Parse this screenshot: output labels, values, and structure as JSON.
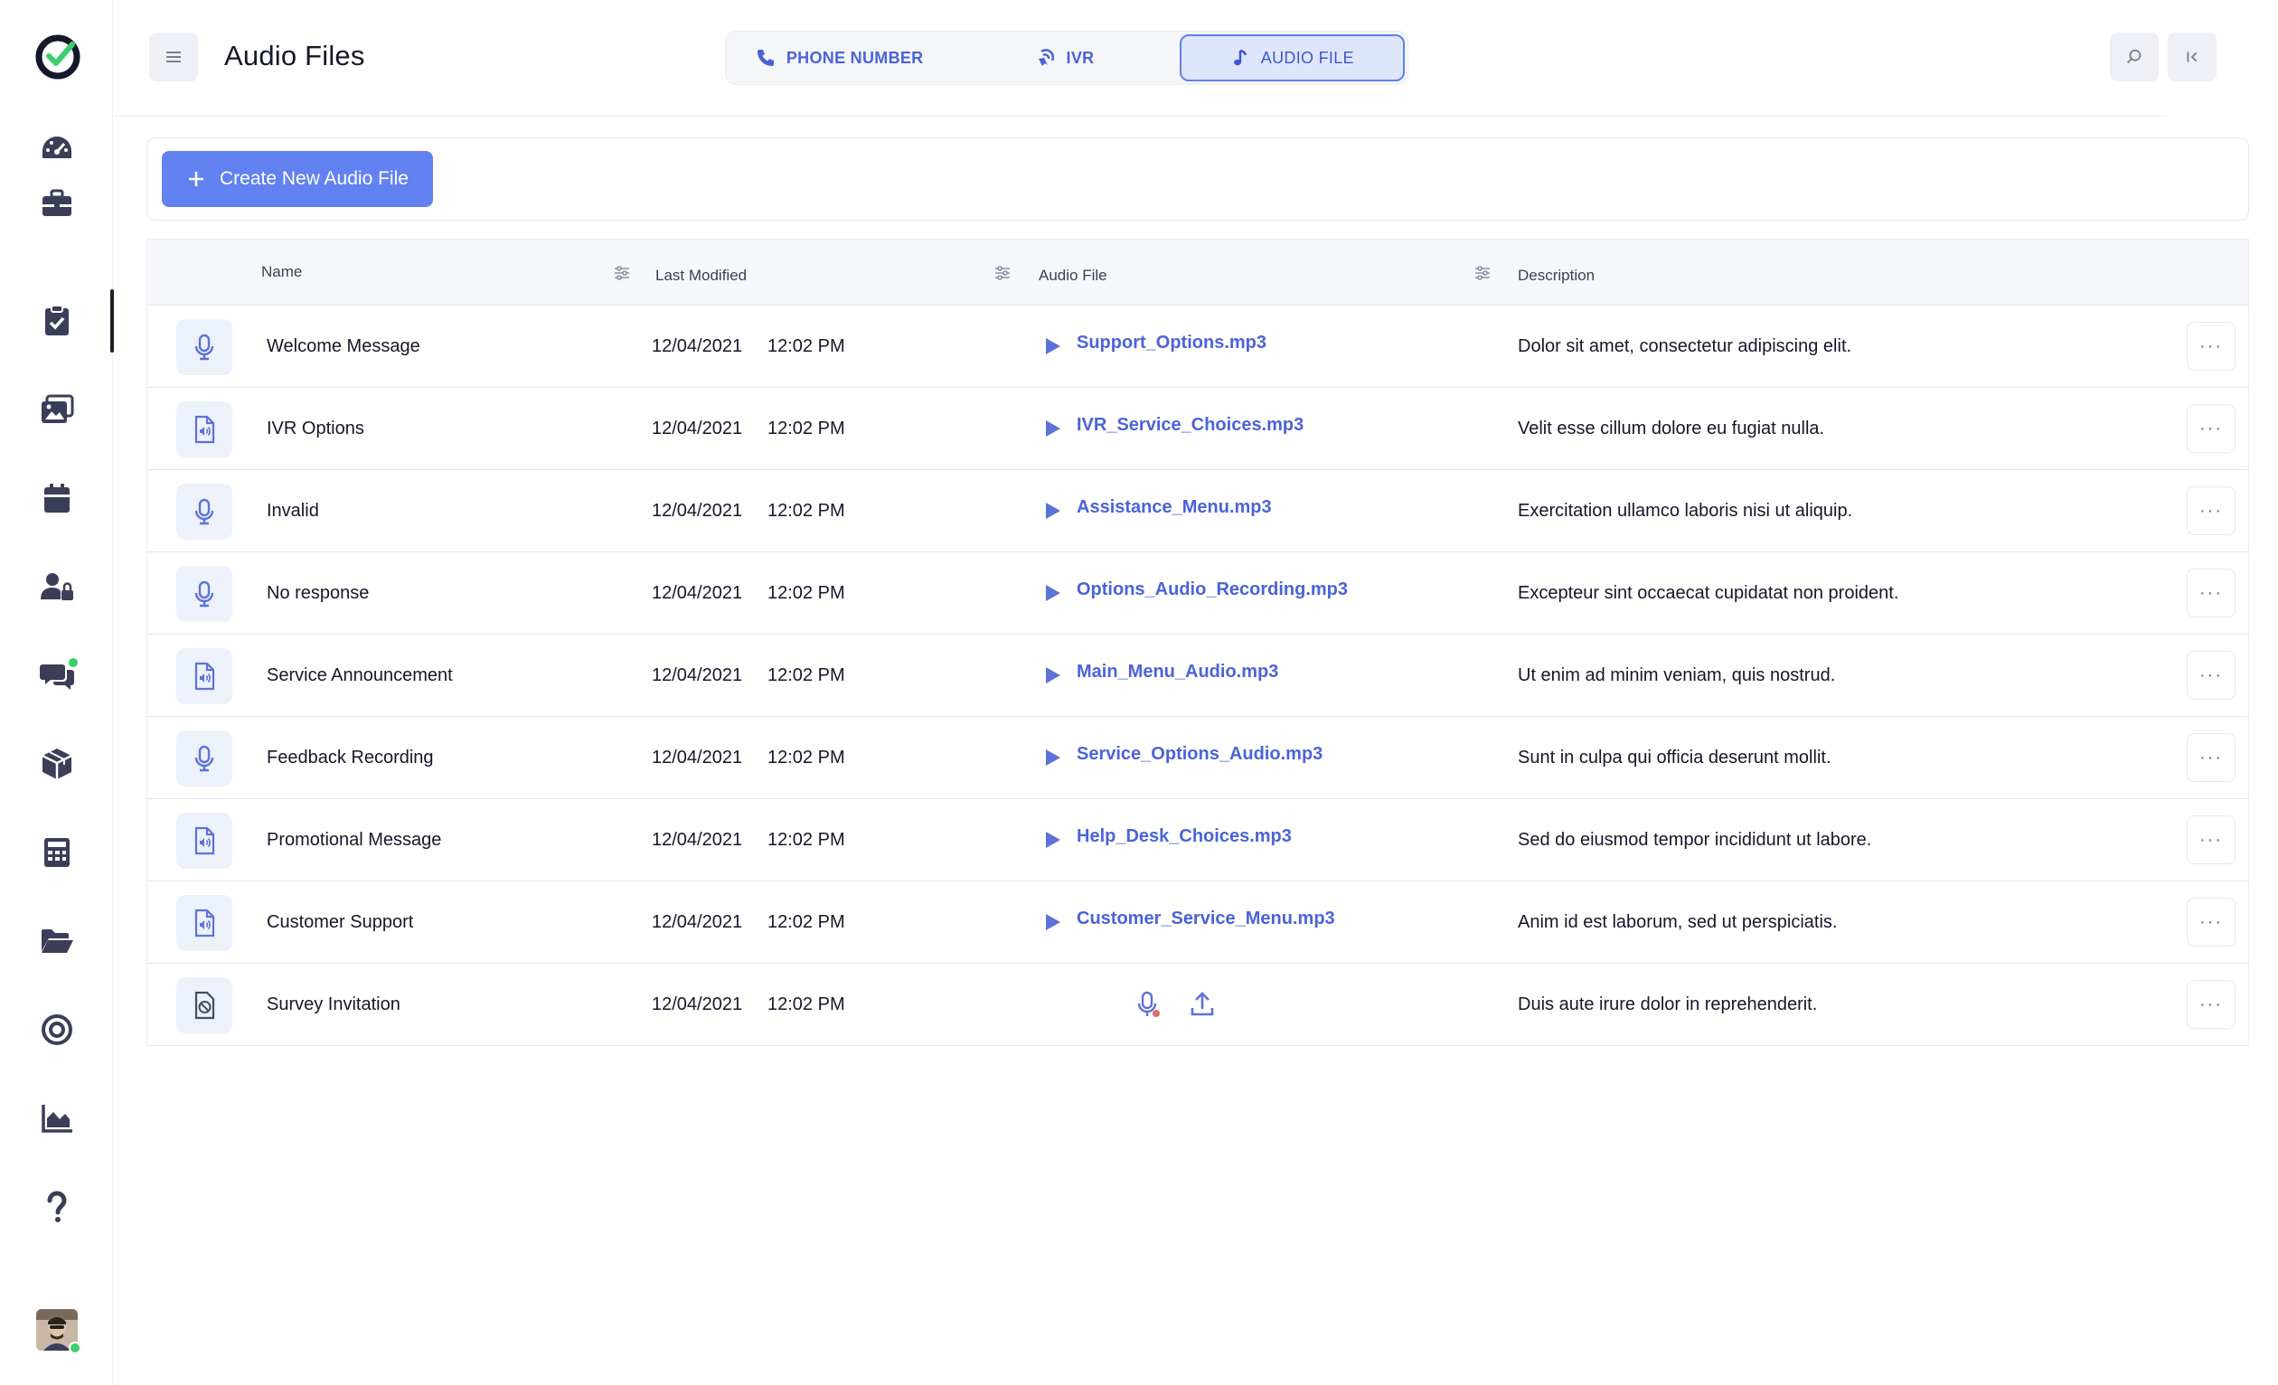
{
  "header": {
    "title": "Audio Files",
    "tabs": [
      {
        "label": "PHONE NUMBER",
        "icon": "phone-icon"
      },
      {
        "label": "IVR",
        "icon": "ivr-icon"
      },
      {
        "label": "AUDIO FILE",
        "icon": "music-note-icon",
        "active": true
      }
    ]
  },
  "sidebar": {
    "items": [
      "dashboard-icon",
      "briefcase-icon",
      "clipboard-check-icon",
      "gallery-icon",
      "calendar-icon",
      "user-lock-icon",
      "chat-icon",
      "box-icon",
      "calculator-icon",
      "folder-open-icon",
      "target-icon",
      "area-chart-icon",
      "help-icon"
    ],
    "active_index": 2
  },
  "toolbar": {
    "create_label": "Create New Audio File"
  },
  "table": {
    "columns": {
      "name": "Name",
      "modified": "Last Modified",
      "file": "Audio File",
      "description": "Description"
    },
    "rows": [
      {
        "icon": "microphone-icon",
        "name": "Welcome Message",
        "date": "12/04/2021",
        "time": "12:02 PM",
        "file": "Support_Options.mp3",
        "description": "Dolor sit amet, consectetur adipiscing elit."
      },
      {
        "icon": "audio-file-icon",
        "name": "IVR Options",
        "date": "12/04/2021",
        "time": "12:02 PM",
        "file": "IVR_Service_Choices.mp3",
        "description": "Velit esse cillum dolore eu fugiat nulla."
      },
      {
        "icon": "microphone-icon",
        "name": "Invalid",
        "date": "12/04/2021",
        "time": "12:02 PM",
        "file": "Assistance_Menu.mp3",
        "description": "Exercitation ullamco laboris nisi ut aliquip."
      },
      {
        "icon": "microphone-icon",
        "name": "No response",
        "date": "12/04/2021",
        "time": "12:02 PM",
        "file": "Options_Audio_Recording.mp3",
        "description": "Excepteur sint occaecat cupidatat non proident."
      },
      {
        "icon": "audio-file-icon",
        "name": "Service Announcement",
        "date": "12/04/2021",
        "time": "12:02 PM",
        "file": "Main_Menu_Audio.mp3",
        "description": "Ut enim ad minim veniam, quis nostrud."
      },
      {
        "icon": "microphone-icon",
        "name": "Feedback Recording",
        "date": "12/04/2021",
        "time": "12:02 PM",
        "file": "Service_Options_Audio.mp3",
        "description": "Sunt in culpa qui officia deserunt mollit."
      },
      {
        "icon": "audio-file-icon",
        "name": "Promotional Message",
        "date": "12/04/2021",
        "time": "12:02 PM",
        "file": "Help_Desk_Choices.mp3",
        "description": "Sed do eiusmod tempor incididunt ut labore."
      },
      {
        "icon": "audio-file-icon",
        "name": "Customer Support",
        "date": "12/04/2021",
        "time": "12:02 PM",
        "file": "Customer_Service_Menu.mp3",
        "description": "Anim id est laborum, sed ut perspiciatis."
      },
      {
        "icon": "no-audio-icon",
        "name": "Survey Invitation",
        "date": "12/04/2021",
        "time": "12:02 PM",
        "file": "",
        "description": "Duis aute irure dolor in reprehenderit."
      }
    ],
    "more_label": "···"
  },
  "colors": {
    "accent": "#6282f2",
    "link": "#4a63d9",
    "icon_tint": "#5d72d8",
    "nav_icon": "#3b3e58",
    "online": "#3ccf6e"
  }
}
